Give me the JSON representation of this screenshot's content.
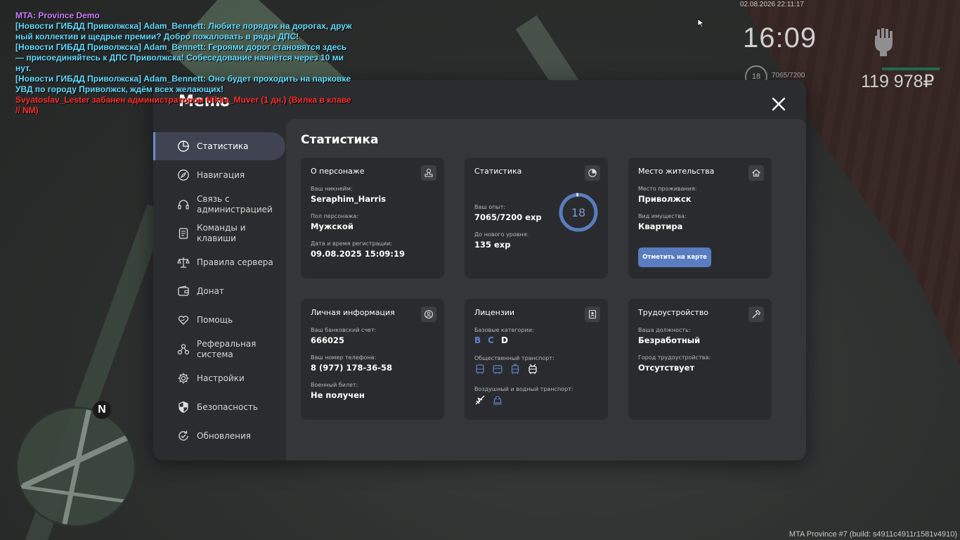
{
  "chat": {
    "title": "MTA: Province Demo",
    "lines": [
      {
        "type": "news",
        "text": "[Новости ГИБДД Приволжска] Adam_Bennett: Любите порядок на дорогах, друж"
      },
      {
        "type": "news",
        "text": "ный коллектив и щедрые премии? Добро пожаловать в ряды ДПС!"
      },
      {
        "type": "news",
        "text": "[Новости ГИБДД Приволжска] Adam_Bennett: Героями дорог становятся здесь"
      },
      {
        "type": "news",
        "text": " — присоединяйтесь к ДПС Приволжска! Собеседование начнётся через 10 ми"
      },
      {
        "type": "news",
        "text": "нут."
      },
      {
        "type": "news",
        "text": "[Новости ГИБДД Приволжска] Adam_Bennett: Оно будет проходить на парковке"
      },
      {
        "type": "news",
        "text": " УВД по городу Приволжск, ждём всех желающих!"
      },
      {
        "type": "ban",
        "text": "Svyatoslav_Lester забанен администратором Nikita_Muver (1 дн.) (Вилка в клаве"
      },
      {
        "type": "ban",
        "text": " // NM)"
      }
    ]
  },
  "hud": {
    "date": "02.08.2026 22:11:17",
    "time": "16:09",
    "level": "18",
    "exp": "7065/7200",
    "money": "119 978₽"
  },
  "build_info": "MTA Province #7 (build: s4911c4911r1581v4910)",
  "minimap": {
    "north": "N"
  },
  "menu": {
    "title": "Меню",
    "sidebar": [
      {
        "label": "Статистика",
        "icon": "pie-chart-icon",
        "active": true
      },
      {
        "label": "Навигация",
        "icon": "compass-icon"
      },
      {
        "label": "Связь с администрацией",
        "icon": "headset-icon"
      },
      {
        "label": "Команды и клавиши",
        "icon": "document-icon"
      },
      {
        "label": "Правила сервера",
        "icon": "scales-icon"
      },
      {
        "label": "Донат",
        "icon": "wallet-icon"
      },
      {
        "label": "Помощь",
        "icon": "heart-hand-icon"
      },
      {
        "label": "Реферальная система",
        "icon": "referral-icon"
      },
      {
        "label": "Настройки",
        "icon": "gear-icon"
      },
      {
        "label": "Безопасность",
        "icon": "shield-icon"
      },
      {
        "label": "Обновления",
        "icon": "refresh-check-icon"
      }
    ],
    "content_title": "Статистика",
    "cards": {
      "character": {
        "title": "О персонаже",
        "nick_label": "Ваш никнейм:",
        "nick": "Seraphim_Harris",
        "gender_label": "Пол персонажа:",
        "gender": "Мужской",
        "reg_label": "Дата и время регистрации:",
        "reg": "09.08.2025 15:09:19"
      },
      "stats": {
        "title": "Статистика",
        "exp_label": "Ваш опыт:",
        "exp": "7065/7200 exp",
        "next_label": "До нового уровня:",
        "next": "135 exp",
        "level": "18",
        "progress": 0.98
      },
      "residence": {
        "title": "Место жительства",
        "place_label": "Место проживания:",
        "place": "Приволжск",
        "property_label": "Вид имущества:",
        "property": "Квартира",
        "button": "Отметить на карте"
      },
      "personal": {
        "title": "Личная информация",
        "bank_label": "Ваш банковский счет:",
        "bank": "666025",
        "phone_label": "Ваш номер телефона:",
        "phone": "8 (977) 178-36-58",
        "military_label": "Военный билет:",
        "military": "Не получен"
      },
      "licenses": {
        "title": "Лицензии",
        "base_label": "Базовые категории:",
        "cat_b": "B",
        "cat_c": "C",
        "cat_d": "D",
        "public_label": "Общественный транспорт:",
        "air_label": "Воздушный и водный транспорт:"
      },
      "job": {
        "title": "Трудоустройство",
        "position_label": "Ваша должность:",
        "position": "Безработный",
        "city_label": "Город трудоустройства:",
        "city": "Отсутствует"
      }
    }
  },
  "colors": {
    "accent": "#5a7cc0",
    "active_bar": "#6b8cd0",
    "license_on": "#5f83c9"
  }
}
